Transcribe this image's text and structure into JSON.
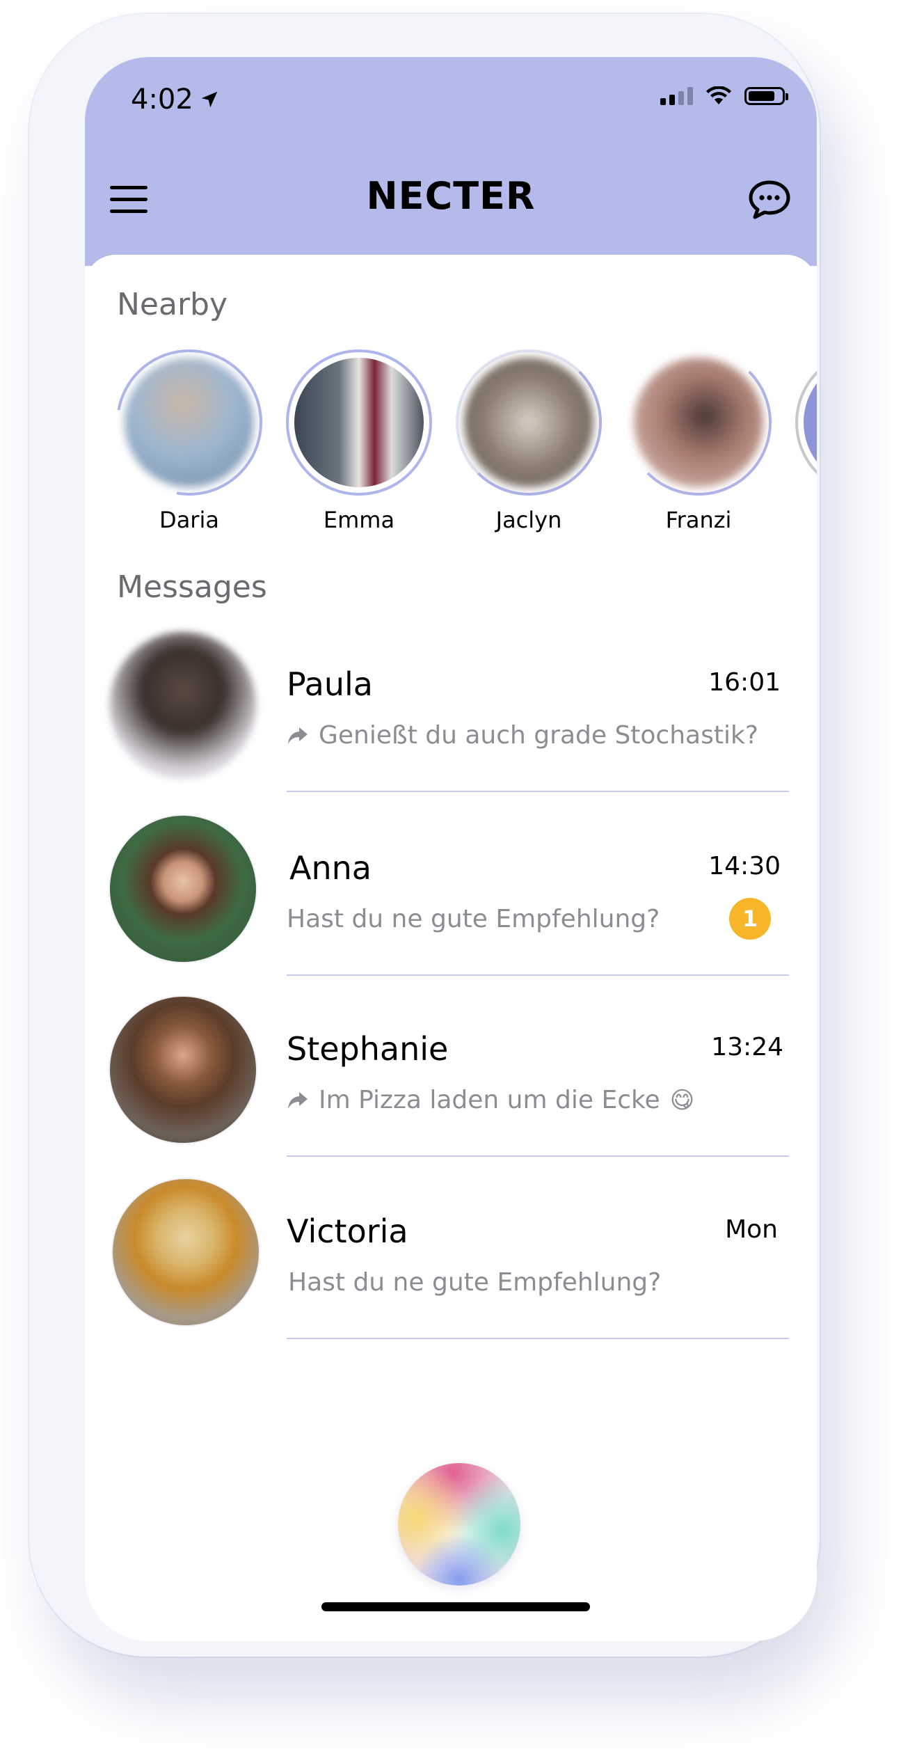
{
  "status_bar": {
    "time": "4:02"
  },
  "header": {
    "title": "NECTER"
  },
  "nearby": {
    "title": "Nearby",
    "people": [
      {
        "name": "Daria",
        "photo_color": "#9fb7cf"
      },
      {
        "name": "Emma",
        "photo_color": "#5a6470"
      },
      {
        "name": "Jaclyn",
        "photo_color": "#8b7c70"
      },
      {
        "name": "Franzi",
        "photo_color": "#a77a6e"
      },
      {
        "name": "",
        "photo_color": "#8d95d8"
      }
    ]
  },
  "messages": {
    "title": "Messages",
    "items": [
      {
        "name": "Paula",
        "time": "16:01",
        "preview": "Genießt du auch grade Stochastik?",
        "replied": true,
        "unread": ""
      },
      {
        "name": "Anna",
        "time": "14:30",
        "preview": "Hast du ne gute Empfehlung?",
        "replied": false,
        "unread": "1"
      },
      {
        "name": "Stephanie",
        "time": "13:24",
        "preview": "Im Pizza laden um die Ecke",
        "emoji": "😋",
        "replied": true,
        "unread": ""
      },
      {
        "name": "Victoria",
        "time": "Mon",
        "preview": "Hast du ne gute Empfehlung?",
        "replied": false,
        "unread": ""
      }
    ]
  },
  "colors": {
    "header_bg": "#b4bbea",
    "accent": "#aeb5ea",
    "badge": "#f7b62a"
  }
}
